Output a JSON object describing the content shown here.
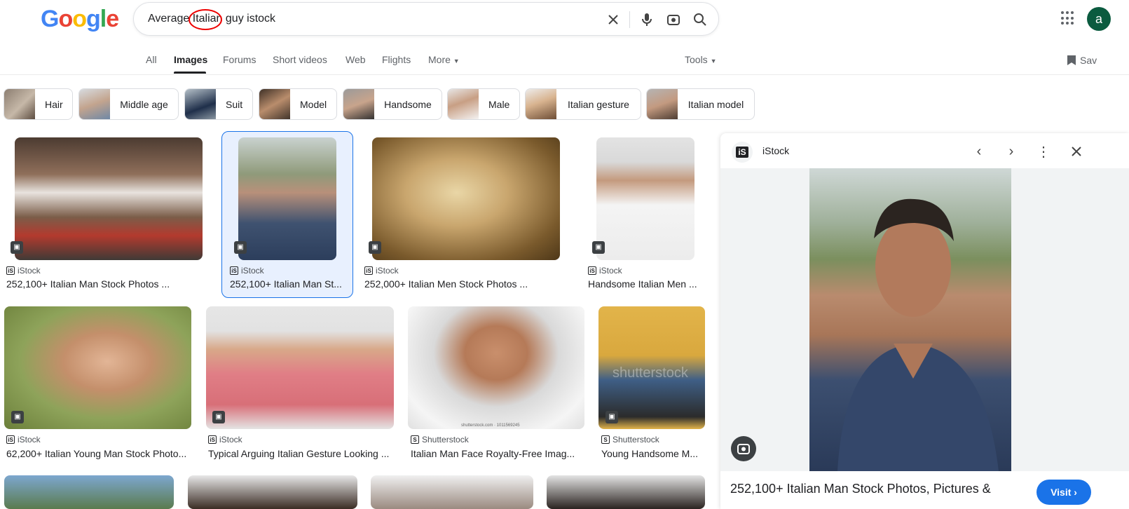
{
  "header": {
    "logo_text": "Google",
    "search_query": "Average Italian guy istock",
    "clear_icon": "close-icon",
    "voice_icon": "mic-icon",
    "lens_icon": "camera-lens-icon",
    "search_icon": "search-icon",
    "apps_icon": "apps-grid-icon",
    "avatar_letter": "a"
  },
  "nav": {
    "tabs": [
      "All",
      "Images",
      "Forums",
      "Short videos",
      "Web",
      "Flights",
      "More"
    ],
    "active_tab": "Images",
    "tools_label": "Tools",
    "save_label": "Sav"
  },
  "chips": [
    "Hair",
    "Middle age",
    "Suit",
    "Model",
    "Handsome",
    "Male",
    "Italian gesture",
    "Italian model"
  ],
  "results": [
    {
      "source": "iStock",
      "title": "252,100+ Italian Man Stock Photos ..."
    },
    {
      "source": "iStock",
      "title": "252,100+ Italian Man St..."
    },
    {
      "source": "iStock",
      "title": "252,000+ Italian Men Stock Photos ..."
    },
    {
      "source": "iStock",
      "title": "Handsome Italian Men ..."
    },
    {
      "source": "iStock",
      "title": "62,200+ Italian Young Man Stock Photo..."
    },
    {
      "source": "iStock",
      "title": "Typical Arguing Italian Gesture Looking ..."
    },
    {
      "source": "Shutterstock",
      "title": "Italian Man Face Royalty-Free Imag..."
    },
    {
      "source": "Shutterstock",
      "title": "Young Handsome M..."
    }
  ],
  "watermarks": {
    "shutterstock": "shutterstock",
    "shutterstock_id": "shutterstock.com · 1011569245"
  },
  "panel": {
    "source": "iStock",
    "title": "252,100+ Italian Man Stock Photos, Pictures &",
    "visit_label": "Visit ›"
  },
  "colors": {
    "accent": "#1a73e8",
    "selected_bg": "#e8f0fe"
  }
}
